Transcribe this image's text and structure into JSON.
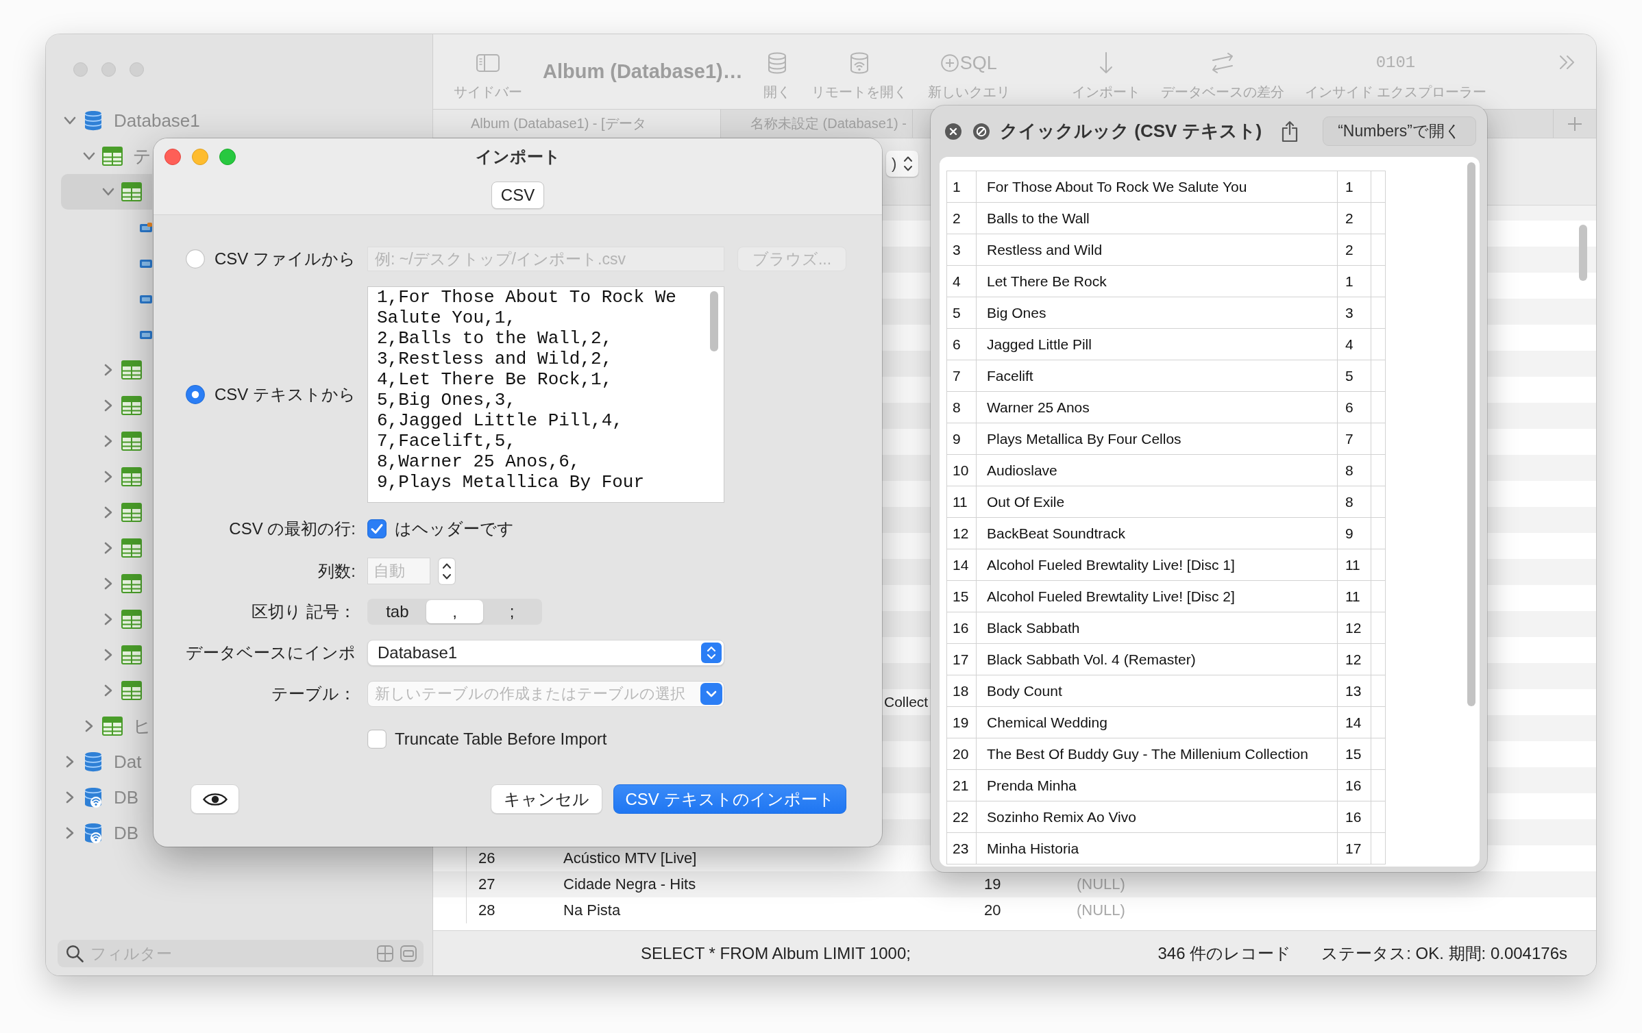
{
  "main_window": {
    "sidebar": {
      "tree": [
        {
          "kind": "database",
          "label": "Database1",
          "expanded": true,
          "selected": false,
          "children": [
            {
              "kind": "table_group",
              "label": "テ",
              "expanded": true,
              "selected": false,
              "children": [
                {
                  "kind": "table",
                  "expanded": true,
                  "selected": true,
                  "children": [
                    {
                      "kind": "column",
                      "primary_key": true,
                      "selected": false
                    },
                    {
                      "kind": "column",
                      "primary_key": false,
                      "selected": false
                    },
                    {
                      "kind": "column",
                      "primary_key": false,
                      "selected": false
                    },
                    {
                      "kind": "column",
                      "primary_key": false,
                      "selected": false
                    }
                  ]
                },
                {
                  "kind": "table",
                  "expanded": false,
                  "selected": false
                },
                {
                  "kind": "table",
                  "expanded": false,
                  "selected": false
                },
                {
                  "kind": "table",
                  "expanded": false,
                  "selected": false
                },
                {
                  "kind": "table",
                  "expanded": false,
                  "selected": false
                },
                {
                  "kind": "table",
                  "expanded": false,
                  "selected": false
                },
                {
                  "kind": "table",
                  "expanded": false,
                  "selected": false
                },
                {
                  "kind": "table",
                  "expanded": false,
                  "selected": false
                },
                {
                  "kind": "table",
                  "expanded": false,
                  "selected": false
                },
                {
                  "kind": "table",
                  "expanded": false,
                  "selected": false
                },
                {
                  "kind": "table",
                  "expanded": false,
                  "selected": false
                }
              ]
            },
            {
              "kind": "table_group",
              "label": "ヒ",
              "expanded": false,
              "selected": false
            }
          ]
        },
        {
          "kind": "database",
          "label": "Dat",
          "expanded": false,
          "selected": false
        },
        {
          "kind": "remote_database",
          "label": "DB",
          "expanded": false,
          "selected": false
        },
        {
          "kind": "remote_database",
          "label": "DB",
          "expanded": false,
          "selected": false
        }
      ],
      "filter": {
        "placeholder": "フィルター"
      }
    },
    "toolbar": {
      "sidebar_button": {
        "label": "サイドバー"
      },
      "title": "Album (Database1)…",
      "items": [
        {
          "kind": "open",
          "label": "開く"
        },
        {
          "kind": "remote",
          "label": "リモートを開く"
        },
        {
          "kind": "sql",
          "glyph": "SQL",
          "label": "新しいクエリ"
        },
        {
          "kind": "import",
          "label": "インポート"
        },
        {
          "kind": "diff",
          "label": "データベースの差分"
        },
        {
          "kind": "binary",
          "glyph": "0101",
          "label": "インサイド エクスプローラー"
        }
      ]
    },
    "tabs": [
      {
        "label": "Album (Database1) - [データ",
        "selected": true
      },
      {
        "label": "名称未設定 (Database1) -",
        "selected": false
      }
    ],
    "query_bar": {
      "popup_value": ")"
    },
    "results": {
      "rows": [
        {
          "kind": "partial",
          "cells": [
            "Collect"
          ]
        },
        {
          "kind": "row",
          "cells": [
            "26",
            "Acústico MTV [Live]"
          ]
        },
        {
          "kind": "row",
          "cells": [
            "27",
            "Cidade Negra - Hits",
            "19",
            "(NULL)"
          ]
        },
        {
          "kind": "row",
          "cells": [
            "28",
            "Na Pista",
            "20",
            "(NULL)"
          ]
        }
      ]
    },
    "status_bar": {
      "query": "SELECT * FROM Album LIMIT 1000;",
      "records": "346 件のレコード",
      "status": "ステータス: OK. 期間: 0.004176s"
    }
  },
  "import_dialog": {
    "title": "インポート",
    "format_tabs": [
      {
        "label": "CSV",
        "selected": true
      }
    ],
    "sources": [
      {
        "kind": "file",
        "label": "CSV ファイルから",
        "selected": false,
        "placeholder": "例: ~/デスクトップ/インポート.csv",
        "browse": {
          "label": "ブラウズ...",
          "disabled": true
        }
      },
      {
        "kind": "text",
        "label": "CSV テキストから",
        "selected": true,
        "value": "1,For Those About To Rock We Salute You,1,\n2,Balls to the Wall,2,\n3,Restless and Wild,2,\n4,Let There Be Rock,1,\n5,Big Ones,3,\n6,Jagged Little Pill,4,\n7,Facelift,5,\n8,Warner 25 Anos,6,\n9,Plays Metallica By Four"
      }
    ],
    "header_row": {
      "label": "CSV の最初の行:",
      "text": "はヘッダーです",
      "checked": true
    },
    "column_count": {
      "label": "列数:",
      "placeholder": "自動"
    },
    "delimiter": {
      "label": "区切り 記号：",
      "options": [
        {
          "label": "tab",
          "selected": false
        },
        {
          "label": ",",
          "selected": true
        },
        {
          "label": ";",
          "selected": false
        }
      ]
    },
    "database": {
      "label": "データベースにインポ",
      "value": "Database1"
    },
    "table": {
      "label": "テーブル：",
      "placeholder": "新しいテーブルの作成またはテーブルの選択"
    },
    "truncate": {
      "label": "Truncate Table Before Import",
      "checked": false
    },
    "buttons": [
      {
        "kind": "preview"
      },
      {
        "kind": "cancel",
        "label": "キャンセル"
      },
      {
        "kind": "confirm",
        "label": "CSV テキストのインポート"
      }
    ]
  },
  "quick_look": {
    "title": "クイックルック (CSV テキスト)",
    "open_button": "“Numbers”で開く",
    "rows": [
      [
        "1",
        "For Those About To Rock We Salute You",
        "1"
      ],
      [
        "2",
        "Balls to the Wall",
        "2"
      ],
      [
        "3",
        "Restless and Wild",
        "2"
      ],
      [
        "4",
        "Let There Be Rock",
        "1"
      ],
      [
        "5",
        "Big Ones",
        "3"
      ],
      [
        "6",
        "Jagged Little Pill",
        "4"
      ],
      [
        "7",
        "Facelift",
        "5"
      ],
      [
        "8",
        "Warner 25 Anos",
        "6"
      ],
      [
        "9",
        "Plays Metallica By Four Cellos",
        "7"
      ],
      [
        "10",
        "Audioslave",
        "8"
      ],
      [
        "11",
        "Out Of Exile",
        "8"
      ],
      [
        "12",
        "BackBeat Soundtrack",
        "9"
      ],
      [
        "14",
        "Alcohol Fueled Brewtality Live! [Disc 1]",
        "11"
      ],
      [
        "15",
        "Alcohol Fueled Brewtality Live! [Disc 2]",
        "11"
      ],
      [
        "16",
        "Black Sabbath",
        "12"
      ],
      [
        "17",
        "Black Sabbath Vol. 4 (Remaster)",
        "12"
      ],
      [
        "18",
        "Body Count",
        "13"
      ],
      [
        "19",
        "Chemical Wedding",
        "14"
      ],
      [
        "20",
        "The Best Of Buddy Guy - The Millenium Collection",
        "15"
      ],
      [
        "21",
        "Prenda Minha",
        "16"
      ],
      [
        "22",
        "Sozinho Remix Ao Vivo",
        "16"
      ],
      [
        "23",
        "Minha Historia",
        "17"
      ]
    ]
  }
}
